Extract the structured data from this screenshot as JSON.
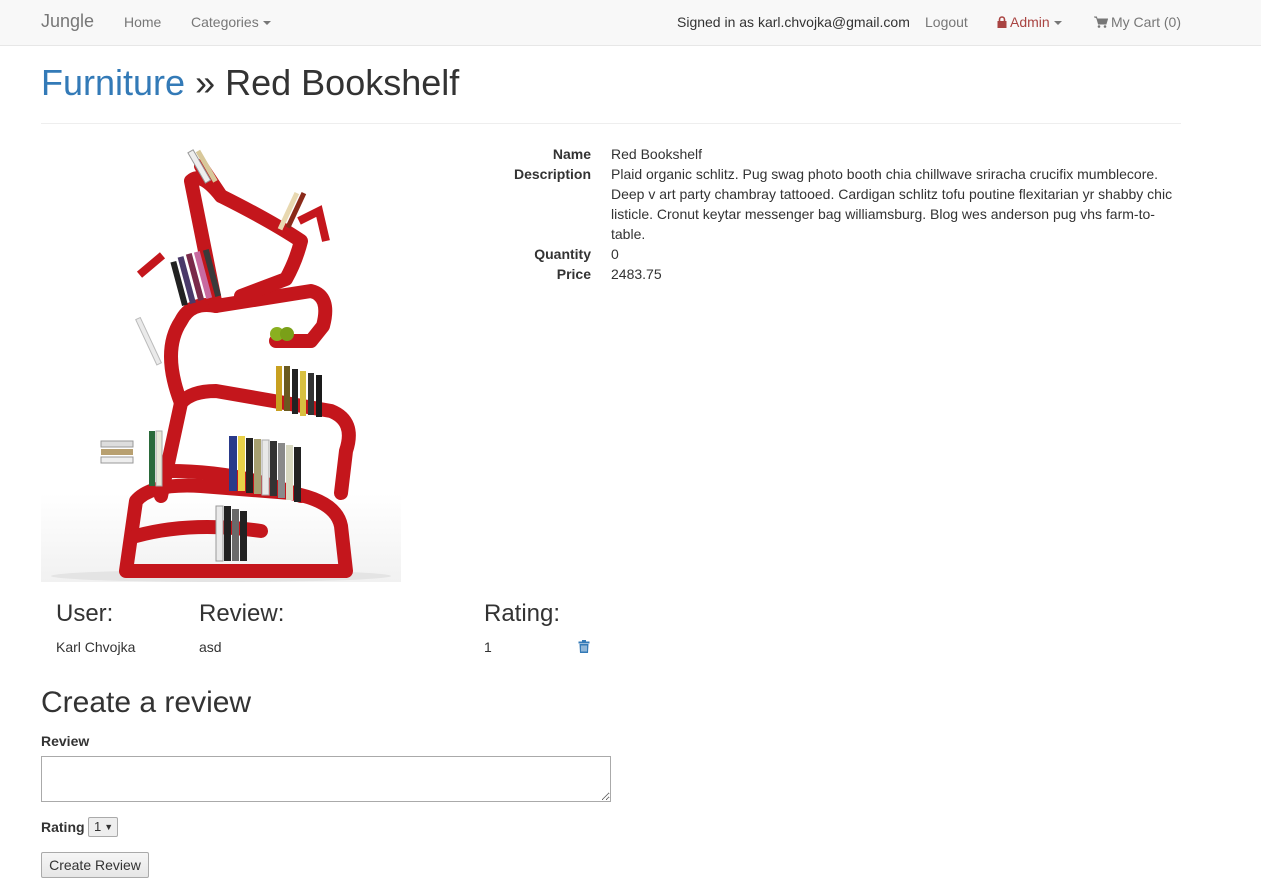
{
  "navbar": {
    "brand": "Jungle",
    "home": "Home",
    "categories": "Categories",
    "signed_in": "Signed in as karl.chvojka@gmail.com",
    "logout": "Logout",
    "admin": "Admin",
    "cart": "My Cart (0)",
    "admin_color": "#a94442"
  },
  "page": {
    "category": "Furniture",
    "separator": "»",
    "product_title": "Red Bookshelf"
  },
  "details": {
    "name_label": "Name",
    "name": "Red Bookshelf",
    "description_label": "Description",
    "description": "Plaid organic schlitz. Pug swag photo booth chia chillwave sriracha crucifix mumblecore. Deep v art party chambray tattooed. Cardigan schlitz tofu poutine flexitarian yr shabby chic listicle. Cronut keytar messenger bag williamsburg. Blog wes anderson pug vhs farm-to-table.",
    "quantity_label": "Quantity",
    "quantity": "0",
    "price_label": "Price",
    "price": "2483.75"
  },
  "reviews": {
    "headers": {
      "user": "User:",
      "review": "Review:",
      "rating": "Rating:"
    },
    "rows": [
      {
        "user": "Karl Chvojka",
        "review": "asd",
        "rating": "1"
      }
    ]
  },
  "form": {
    "heading": "Create a review",
    "review_label": "Review",
    "review_value": "",
    "rating_label": "Rating",
    "rating_selected": "1",
    "submit": "Create Review"
  },
  "colors": {
    "link": "#337ab7",
    "product": "#c4161c"
  }
}
